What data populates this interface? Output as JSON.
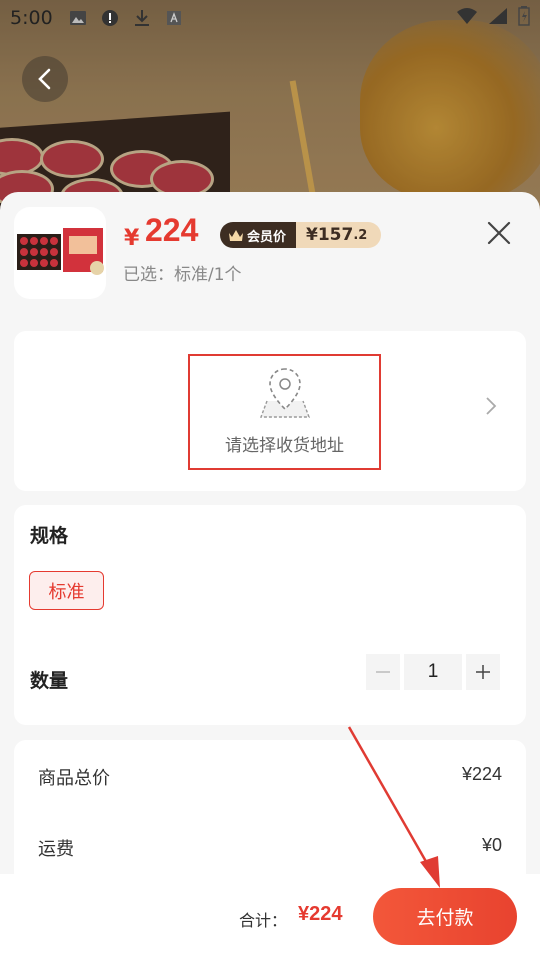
{
  "status_bar": {
    "time": "5:00"
  },
  "product": {
    "price_currency": "¥",
    "price": "224",
    "member_label": "会员价",
    "member_price_main": "¥157",
    "member_price_decimal": ".2",
    "selected": "已选：标准/1个"
  },
  "address": {
    "placeholder": "请选择收货地址"
  },
  "spec": {
    "title": "规格",
    "options": [
      "标准"
    ],
    "quantity_label": "数量",
    "quantity": "1"
  },
  "summary": {
    "rows": [
      {
        "label": "商品总价",
        "value": "¥224"
      },
      {
        "label": "运费",
        "value": "¥0"
      }
    ]
  },
  "footer": {
    "total_label": "合计：",
    "total_value": "¥224",
    "pay_label": "去付款"
  },
  "colors": {
    "accent": "#e53a30",
    "member_dark": "#3d2d22",
    "member_light": "#f0d9b9"
  },
  "icons": [
    "back-arrow-icon",
    "close-icon",
    "location-pin-icon",
    "chevron-right-icon",
    "minus-icon",
    "plus-icon",
    "crown-icon"
  ]
}
